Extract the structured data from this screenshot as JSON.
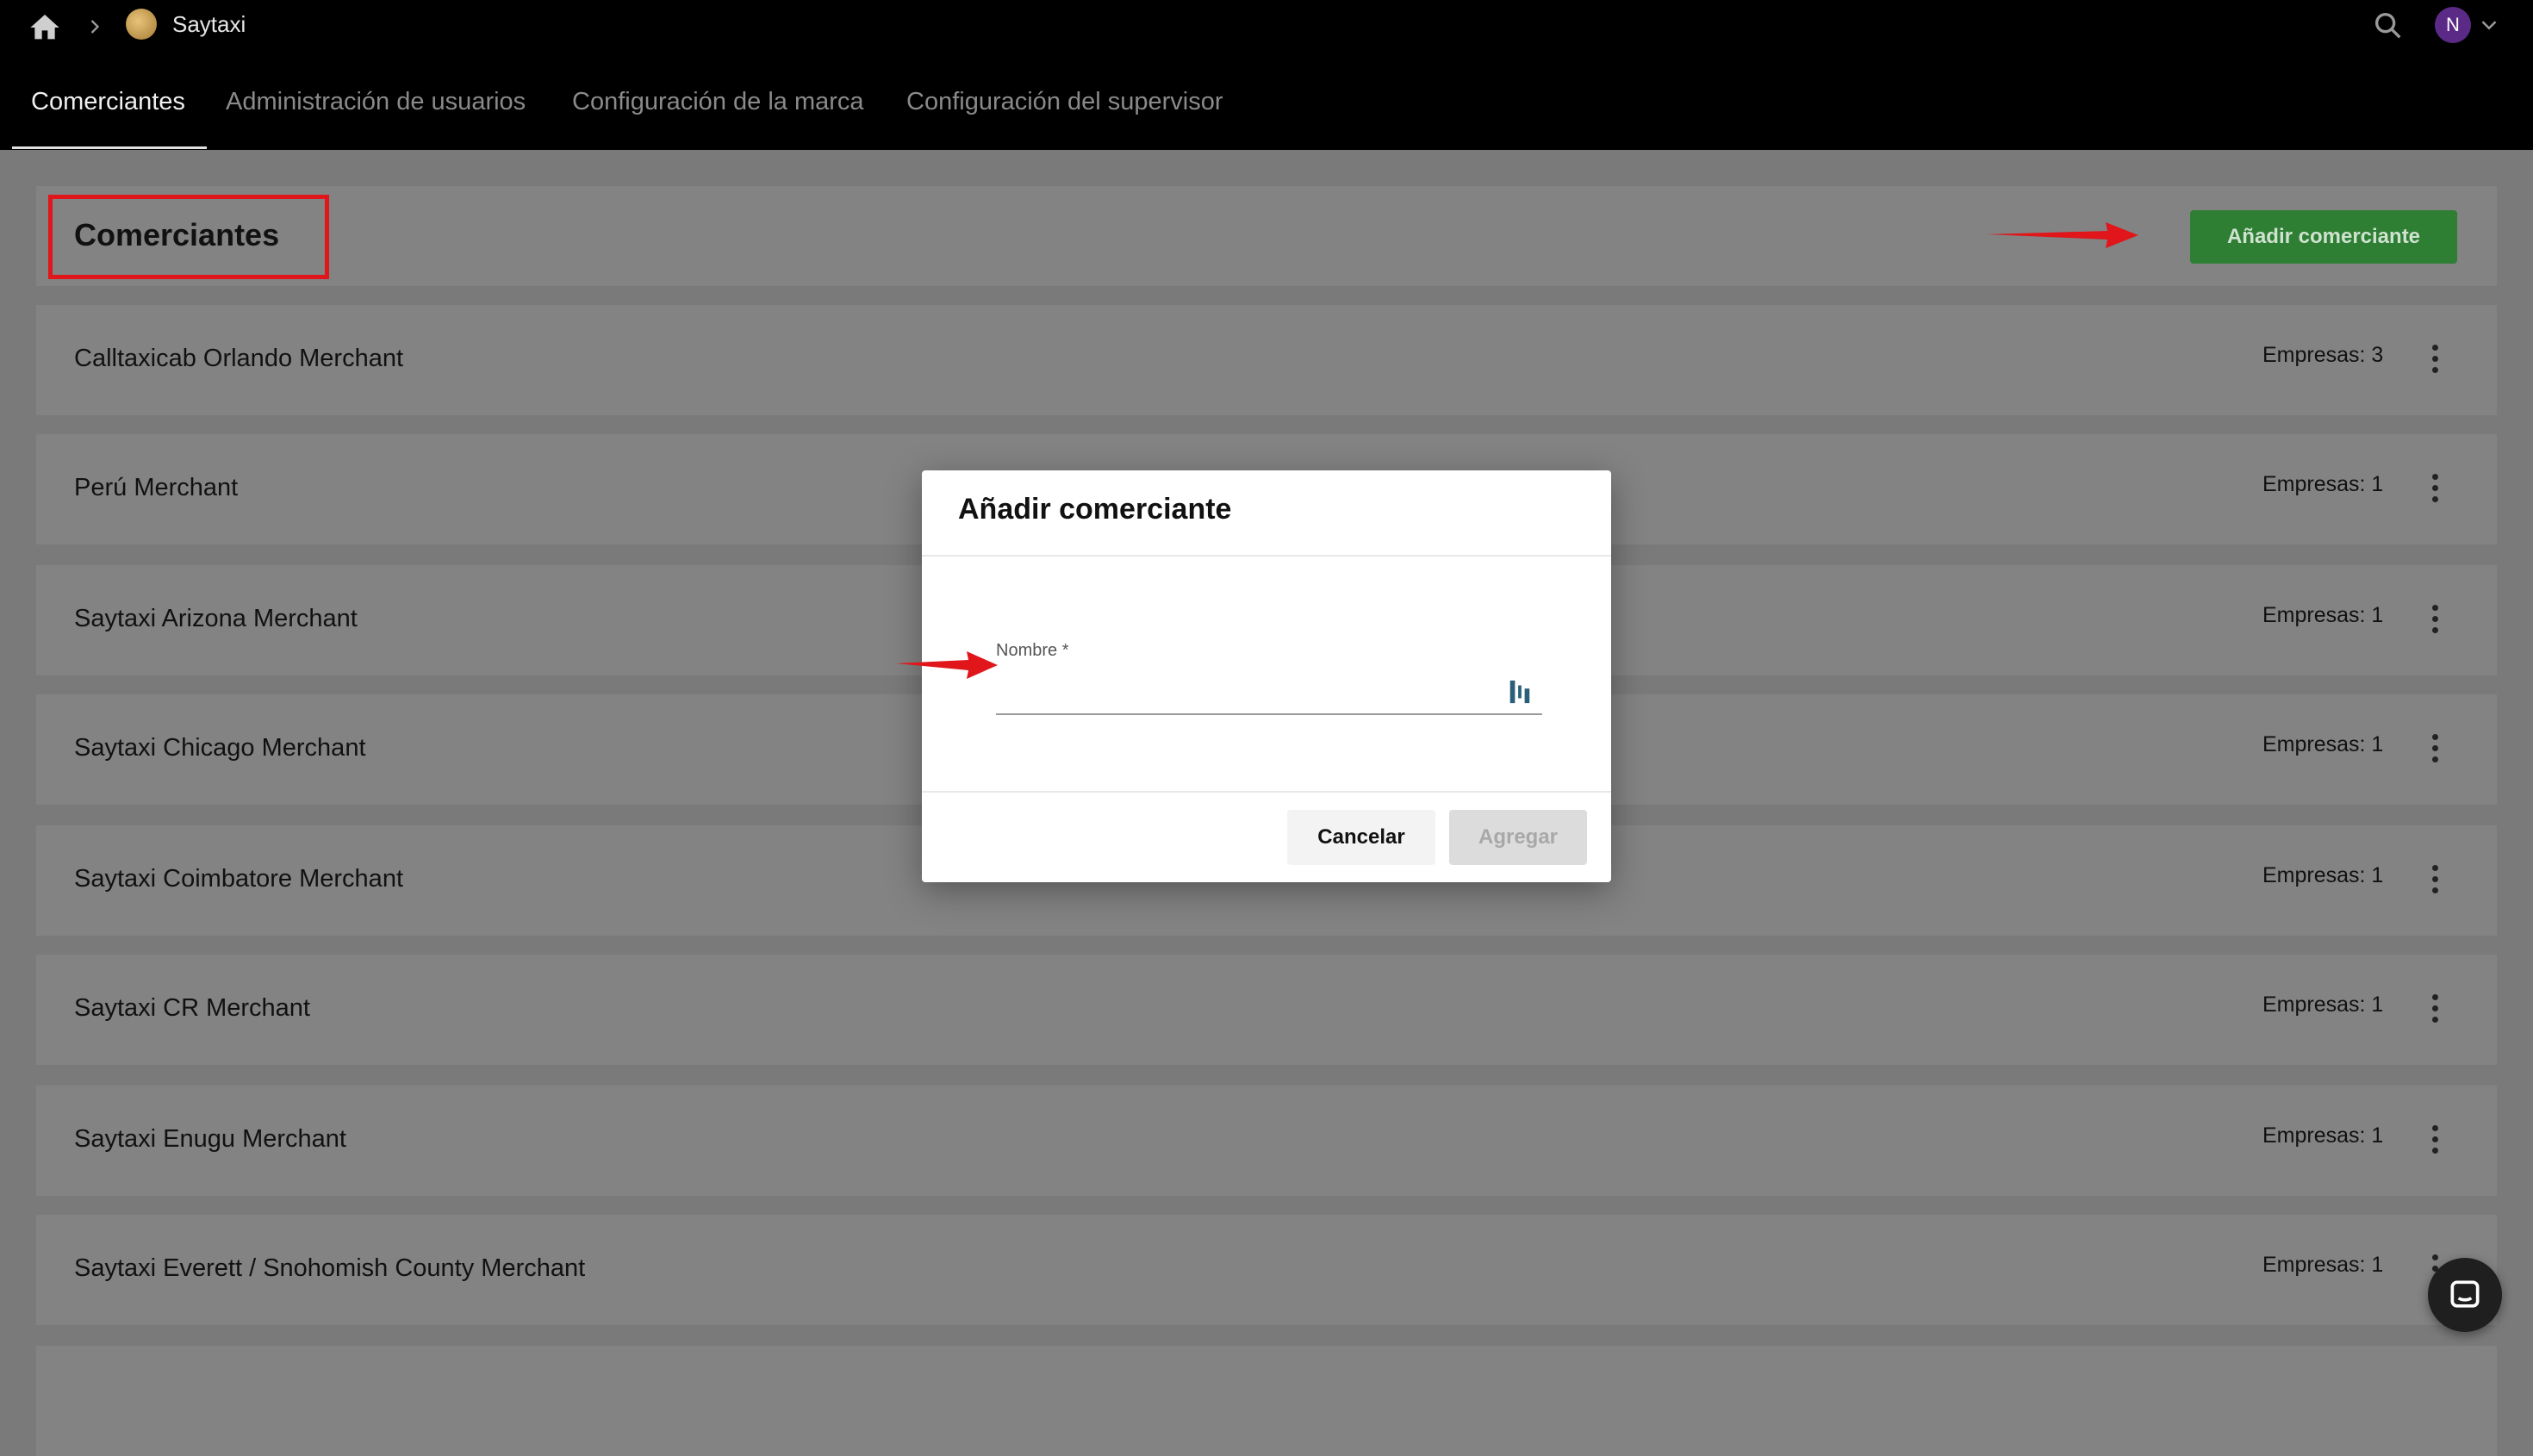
{
  "topbar": {
    "brand_name": "Saytaxi",
    "avatar_initial": "N",
    "icons": [
      "home-icon",
      "chevron-right-icon",
      "search-icon",
      "chevron-down-icon"
    ]
  },
  "tabs": [
    {
      "label": "Comerciantes",
      "active": true
    },
    {
      "label": "Administración de usuarios",
      "active": false
    },
    {
      "label": "Configuración de la marca",
      "active": false
    },
    {
      "label": "Configuración del supervisor",
      "active": false
    }
  ],
  "page": {
    "title": "Comerciantes",
    "add_button": "Añadir comerciante",
    "accent_color": "#2e7e34",
    "annotation_color": "#e0161b"
  },
  "merchants": [
    {
      "name": "Calltaxicab Orlando Merchant",
      "count": "Empresas: 3"
    },
    {
      "name": "Perú Merchant",
      "count": "Empresas: 1"
    },
    {
      "name": "Saytaxi Arizona Merchant",
      "count": "Empresas: 1"
    },
    {
      "name": "Saytaxi Chicago Merchant",
      "count": "Empresas: 1"
    },
    {
      "name": "Saytaxi Coimbatore Merchant",
      "count": "Empresas: 1"
    },
    {
      "name": "Saytaxi CR Merchant",
      "count": "Empresas: 1"
    },
    {
      "name": "Saytaxi Enugu Merchant",
      "count": "Empresas: 1"
    },
    {
      "name": "Saytaxi Everett / Snohomish County Merchant",
      "count": "Empresas: 1"
    }
  ],
  "dialog": {
    "title": "Añadir comerciante",
    "field_label": "Nombre *",
    "field_value": "",
    "cancel": "Cancelar",
    "submit": "Agregar"
  }
}
